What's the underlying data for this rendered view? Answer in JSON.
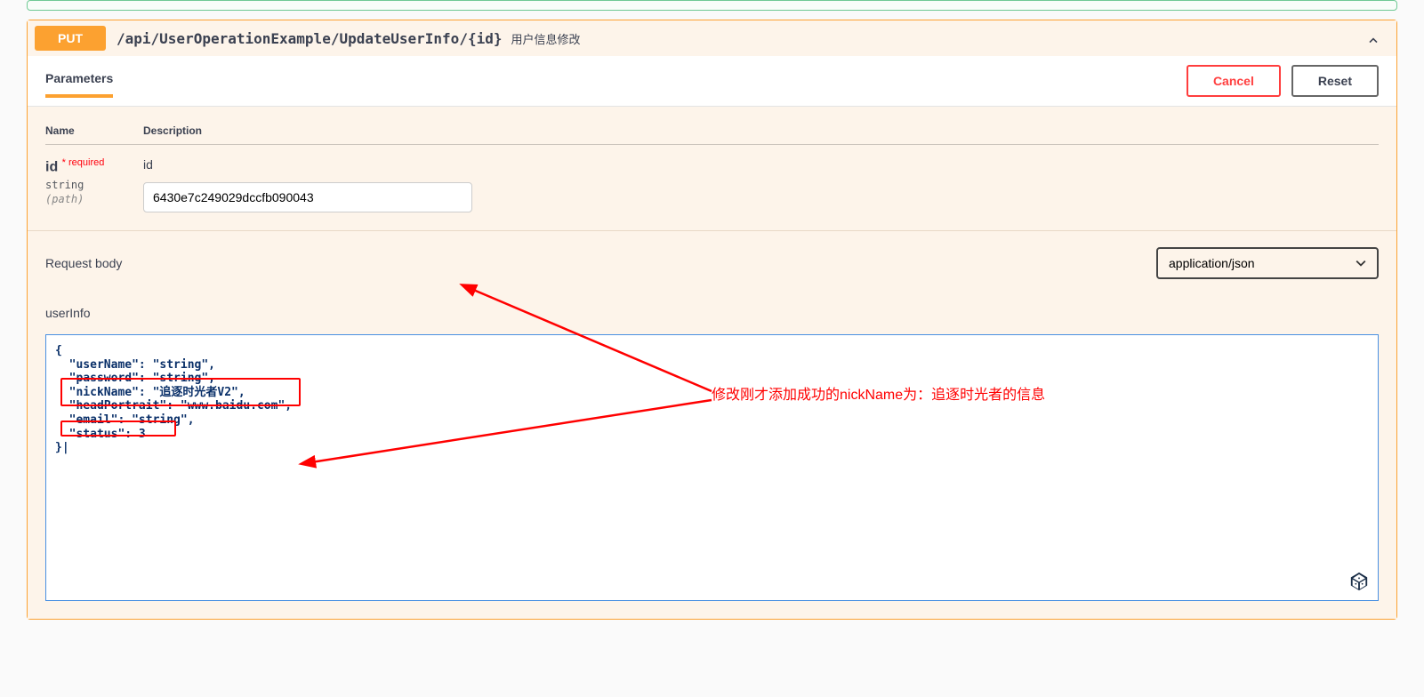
{
  "method": "PUT",
  "path": "/api/UserOperationExample/UpdateUserInfo/{id}",
  "summary": "用户信息修改",
  "tabs": {
    "parameters": "Parameters"
  },
  "buttons": {
    "cancel": "Cancel",
    "reset": "Reset"
  },
  "columns": {
    "name": "Name",
    "description": "Description"
  },
  "param": {
    "name": "id",
    "required": "* required",
    "type": "string",
    "in": "(path)",
    "desc": "id",
    "value": "6430e7c249029dccfb090043"
  },
  "requestBody": {
    "label": "Request body",
    "contentType": "application/json",
    "userInfoLabel": "userInfo",
    "json": "{\n  \"userName\": \"string\",\n  \"password\": \"string\",\n  \"nickName\": \"追逐时光者V2\",\n  \"headPortrait\": \"www.baidu.com\",\n  \"email\": \"string\",\n  \"status\": 3\n}|"
  },
  "annotation": "修改刚才添加成功的nickName为：追逐时光者的信息"
}
